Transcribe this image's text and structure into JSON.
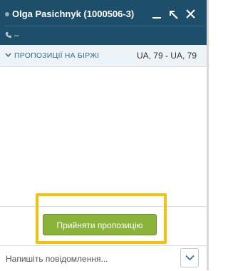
{
  "header": {
    "contact_name": "Olga Pasichnyk (1000506-3)",
    "phone_text": "–",
    "icons": [
      "status-dot",
      "minimize-icon",
      "popout-icon",
      "close-icon",
      "phone-icon"
    ]
  },
  "offer_bar": {
    "label": "ПРОПОЗИЦІЇ НА БІРЖІ",
    "value": "UA, 79 - UA, 79"
  },
  "actions": {
    "accept_label": "Прийняти пропозицію"
  },
  "composer": {
    "placeholder": "Напишіть повідомлення..."
  },
  "colors": {
    "header_bg": "#1d4f6b",
    "accept_bg": "#8ab33a",
    "highlight": "#f4c20d",
    "subbar_bg": "#eef3f7"
  }
}
